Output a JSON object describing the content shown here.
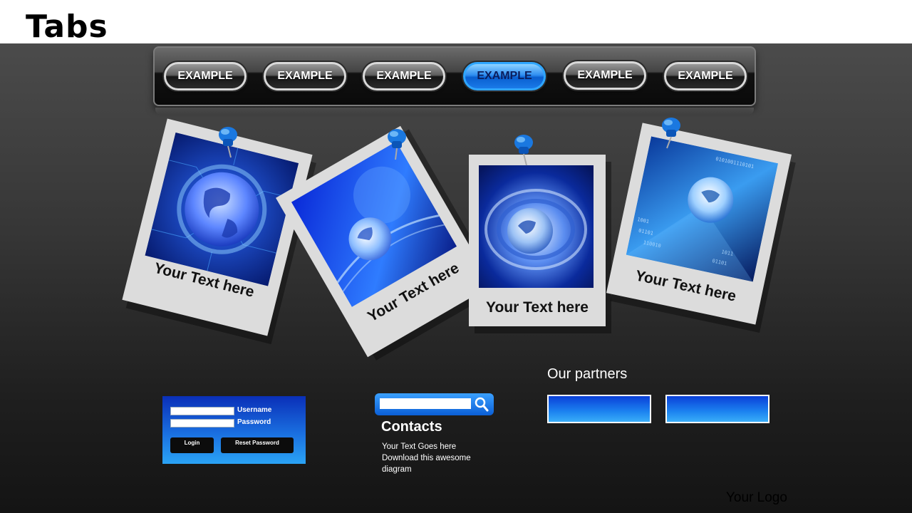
{
  "title": "Tabs",
  "tabs": [
    {
      "label": "EXAMPLE",
      "active": false
    },
    {
      "label": "EXAMPLE",
      "active": false
    },
    {
      "label": "EXAMPLE",
      "active": false
    },
    {
      "label": "EXAMPLE",
      "active": true
    },
    {
      "label": "EXAMPLE",
      "active": false
    },
    {
      "label": "EXAMPLE",
      "active": false
    }
  ],
  "photos": [
    {
      "caption": "Your Text here",
      "icon": "globe-circuit-image"
    },
    {
      "caption": "Your Text here",
      "icon": "globe-network-image"
    },
    {
      "caption": "Your Text here",
      "icon": "globe-swirl-image"
    },
    {
      "caption": "Your Text here",
      "icon": "globe-binary-image"
    }
  ],
  "login": {
    "username_label": "Username",
    "password_label": "Password",
    "login_button": "Login",
    "reset_button": "Reset Password"
  },
  "contacts": {
    "title": "Contacts",
    "lines": [
      "Your Text  Goes here",
      "Download this awesome",
      "diagram"
    ]
  },
  "partners": {
    "title": "Our partners"
  },
  "logo": "Your Logo",
  "colors": {
    "accent": "#1a7ae8",
    "background": "#2b2b2b"
  }
}
